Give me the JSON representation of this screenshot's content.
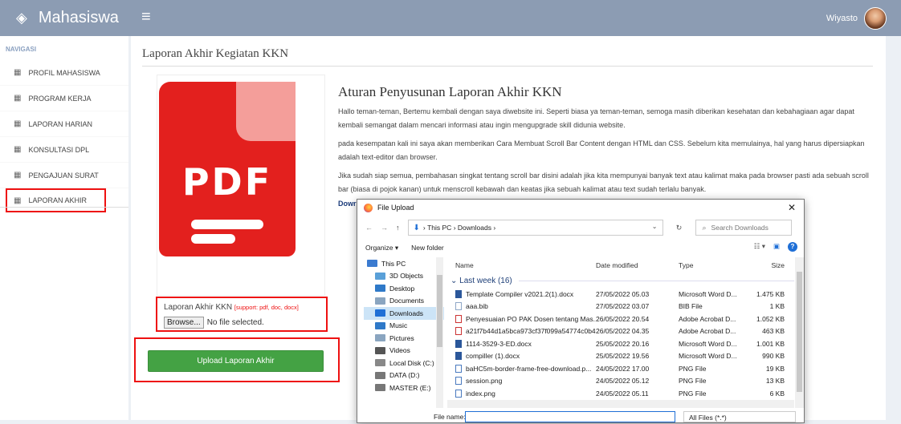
{
  "app": {
    "brand": "Mahasiswa",
    "user": "Wiyasto"
  },
  "sidebar": {
    "header": "NAVIGASI",
    "items": [
      {
        "label": "PROFIL MAHASISWA"
      },
      {
        "label": "PROGRAM KERJA"
      },
      {
        "label": "LAPORAN HARIAN"
      },
      {
        "label": "KONSULTASI DPL"
      },
      {
        "label": "PENGAJUAN SURAT"
      },
      {
        "label": "LAPORAN AKHIR",
        "active": true
      }
    ]
  },
  "page": {
    "title": "Laporan Akhir Kegiatan KKN",
    "thumbnail_text": "PDF",
    "file_label": "Laporan Akhir KKN",
    "file_support": "[support: pdf, doc, docx]",
    "browse_label": "Browse...",
    "no_file": "No file selected.",
    "upload_button": "Upload Laporan Akhir"
  },
  "article": {
    "heading": "Aturan Penyusunan Laporan Akhir KKN",
    "p1": "Hallo teman-teman, Bertemu kembali dengan saya diwebsite ini. Seperti biasa ya teman-teman, semoga masih diberikan kesehatan dan kebahagiaan agar dapat kembali semangat dalam mencari informasi atau ingin mengupgrade skill didunia website.",
    "p2": "pada kesempatan kali ini saya akan memberikan Cara Membuat Scroll Bar Content dengan HTML dan CSS. Sebelum kita memulainya, hal yang harus dipersiapkan adalah text-editor dan browser.",
    "p3": "Jika sudah siap semua, pembahasan singkat tentang scroll bar disini adalah jika kita mempunyai banyak text atau kalimat maka pada browser pasti ada sebuah scroll bar (biasa di pojok kanan) untuk menscroll kebawah dan keatas jika sebuah kalimat atau text sudah terlalu banyak.",
    "download_partial": "Dowr"
  },
  "dialog": {
    "title": "File Upload",
    "close": "✕",
    "path": [
      "This PC",
      "Downloads"
    ],
    "search_placeholder": "Search Downloads",
    "organize": "Organize ▾",
    "new_folder": "New folder",
    "tree": [
      {
        "label": "This PC",
        "color": "#3b7bd0"
      },
      {
        "label": "3D Objects",
        "color": "#5aa0d8"
      },
      {
        "label": "Desktop",
        "color": "#2f79c8"
      },
      {
        "label": "Documents",
        "color": "#8aa5c0"
      },
      {
        "label": "Downloads",
        "color": "#1f6fd6",
        "selected": true
      },
      {
        "label": "Music",
        "color": "#2f79c8"
      },
      {
        "label": "Pictures",
        "color": "#8aa5c0"
      },
      {
        "label": "Videos",
        "color": "#555"
      },
      {
        "label": "Local Disk (C:)",
        "color": "#888"
      },
      {
        "label": "DATA (D:)",
        "color": "#777"
      },
      {
        "label": "MASTER (E:)",
        "color": "#777"
      }
    ],
    "columns": [
      "Name",
      "Date modified",
      "Type",
      "Size"
    ],
    "group": "Last week (16)",
    "files": [
      {
        "name": "Template Compiler v2021.2(1).docx",
        "date": "27/05/2022 05.03",
        "type": "Microsoft Word D...",
        "size": "1.475 KB",
        "kind": "word"
      },
      {
        "name": "aaa.bib",
        "date": "27/05/2022 03.07",
        "type": "BIB File",
        "size": "1 KB",
        "kind": "file"
      },
      {
        "name": "Penyesuaian PO PAK Dosen tentang Mas...",
        "date": "26/05/2022 20.54",
        "type": "Adobe Acrobat D...",
        "size": "1.052 KB",
        "kind": "pdf"
      },
      {
        "name": "a21f7b44d1a5bca973cf37f099a54774c0b4....",
        "date": "26/05/2022 04.35",
        "type": "Adobe Acrobat D...",
        "size": "463 KB",
        "kind": "pdf"
      },
      {
        "name": "1114-3529-3-ED.docx",
        "date": "25/05/2022 20.16",
        "type": "Microsoft Word D...",
        "size": "1.001 KB",
        "kind": "word"
      },
      {
        "name": "compiller (1).docx",
        "date": "25/05/2022 19.56",
        "type": "Microsoft Word D...",
        "size": "990 KB",
        "kind": "word"
      },
      {
        "name": "baHC5m-border-frame-free-download.p...",
        "date": "24/05/2022 17.00",
        "type": "PNG File",
        "size": "19 KB",
        "kind": "png"
      },
      {
        "name": "session.png",
        "date": "24/05/2022 05.12",
        "type": "PNG File",
        "size": "13 KB",
        "kind": "png"
      },
      {
        "name": "index.png",
        "date": "24/05/2022 05.11",
        "type": "PNG File",
        "size": "6 KB",
        "kind": "png"
      }
    ],
    "filename_label": "File name:",
    "filter": "All Files (*.*)"
  }
}
